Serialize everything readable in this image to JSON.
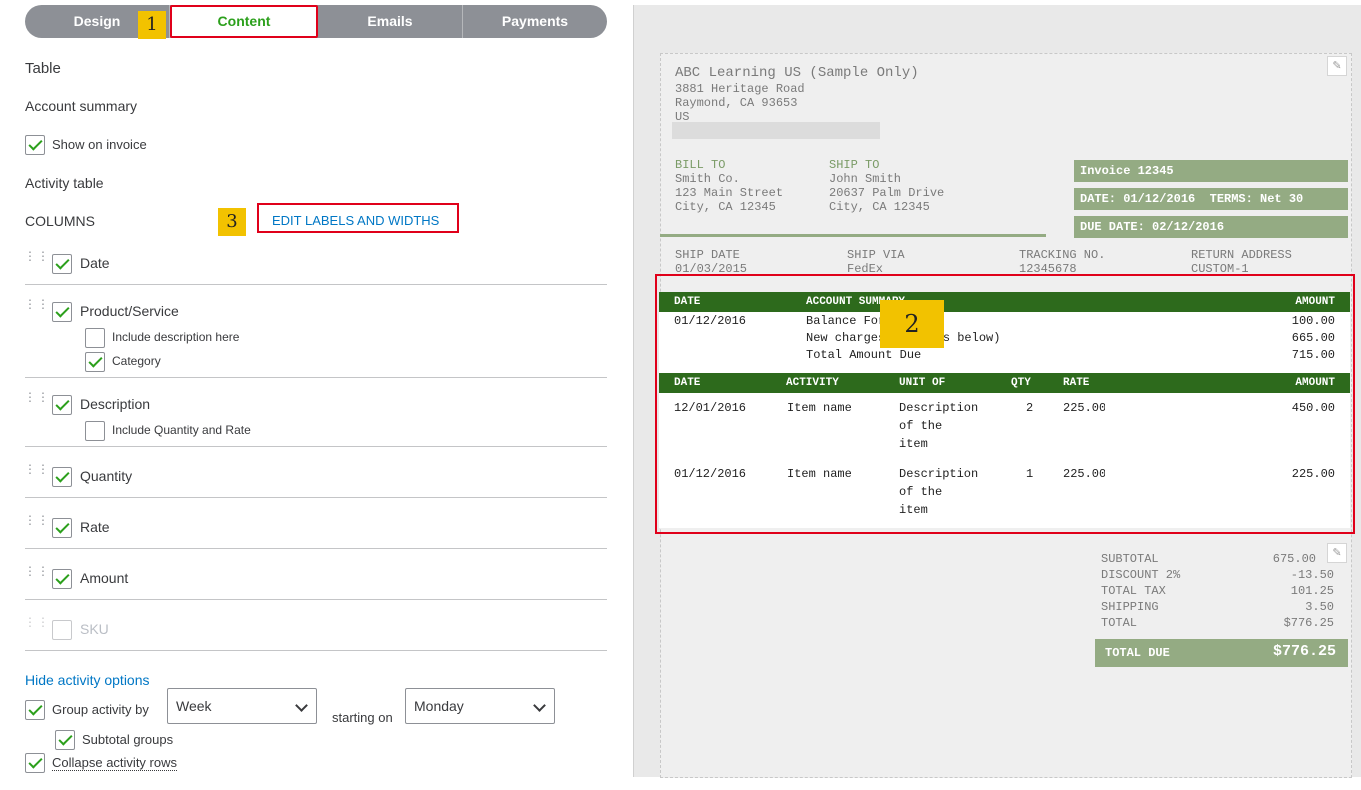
{
  "tabs": [
    {
      "label": "Design"
    },
    {
      "label": "Content"
    },
    {
      "label": "Emails"
    },
    {
      "label": "Payments"
    }
  ],
  "badges": {
    "b1": "1",
    "b2": "2",
    "b3": "3"
  },
  "settings": {
    "section_title": "Table",
    "account_summary": "Account summary",
    "show_on_invoice": "Show on invoice",
    "activity_table": "Activity table",
    "columns_label": "COLUMNS",
    "edit_labels": "EDIT LABELS AND WIDTHS",
    "columns": {
      "date": "Date",
      "product_service": "Product/Service",
      "include_description": "Include description here",
      "category": "Category",
      "description": "Description",
      "include_qty_rate": "Include Quantity and Rate",
      "quantity": "Quantity",
      "rate": "Rate",
      "amount": "Amount",
      "sku": "SKU"
    },
    "hide_activity_options": "Hide activity options",
    "group_activity_by": "Group activity by",
    "group_value": "Week",
    "starting_on": "starting on",
    "starting_value": "Monday",
    "subtotal_groups": "Subtotal groups",
    "collapse_rows": "Collapse activity rows"
  },
  "invoice": {
    "company": "ABC Learning US (Sample Only)",
    "address1": "3881 Heritage Road",
    "address2": "Raymond, CA 93653",
    "country": "US",
    "bill_to_label": "BILL TO",
    "bill_to": [
      "Smith Co.",
      "123 Main Street",
      "City, CA 12345"
    ],
    "ship_to_label": "SHIP TO",
    "ship_to": [
      "John Smith",
      "20637 Palm Drive",
      "City, CA 12345"
    ],
    "invoice_no": "Invoice 12345",
    "date_line": "DATE: 01/12/2016",
    "terms": "TERMS: Net 30",
    "due_date": "DUE DATE: 02/12/2016",
    "ship_date_label": "SHIP DATE",
    "ship_date": "01/03/2015",
    "ship_via_label": "SHIP VIA",
    "ship_via": "FedEx",
    "tracking_label": "TRACKING NO.",
    "tracking": "12345678",
    "return_label": "RETURN ADDRESS",
    "return": "CUSTOM-1",
    "summary_headers": {
      "date": "DATE",
      "account_summary": "ACCOUNT SUMMARY",
      "amount": "AMOUNT"
    },
    "summary_date": "01/12/2016",
    "summary_rows": [
      {
        "label": "Balance Forward",
        "amount": "100.00"
      },
      {
        "label": "New charges (details below)",
        "amount": "665.00"
      },
      {
        "label": "Total Amount Due",
        "amount": "715.00"
      }
    ],
    "activity_headers": {
      "date": "DATE",
      "activity": "ACTIVITY",
      "unit": "UNIT OF",
      "qty": "QTY",
      "rate": "RATE",
      "amount": "AMOUNT"
    },
    "activity_rows": [
      {
        "date": "12/01/2016",
        "activity": "Item name",
        "desc": "Description\nof the\nitem",
        "qty": "2",
        "rate": "225.00",
        "amount": "450.00"
      },
      {
        "date": "01/12/2016",
        "activity": "Item name",
        "desc": "Description\nof the\nitem",
        "qty": "1",
        "rate": "225.00",
        "amount": "225.00"
      }
    ],
    "totals": [
      {
        "label": "SUBTOTAL",
        "value": "675.00"
      },
      {
        "label": "DISCOUNT 2%",
        "value": "-13.50"
      },
      {
        "label": "TOTAL TAX",
        "value": "101.25"
      },
      {
        "label": "SHIPPING",
        "value": "3.50"
      },
      {
        "label": "TOTAL",
        "value": "$776.25"
      }
    ],
    "total_due_label": "TOTAL DUE",
    "total_due": "$776.25"
  }
}
